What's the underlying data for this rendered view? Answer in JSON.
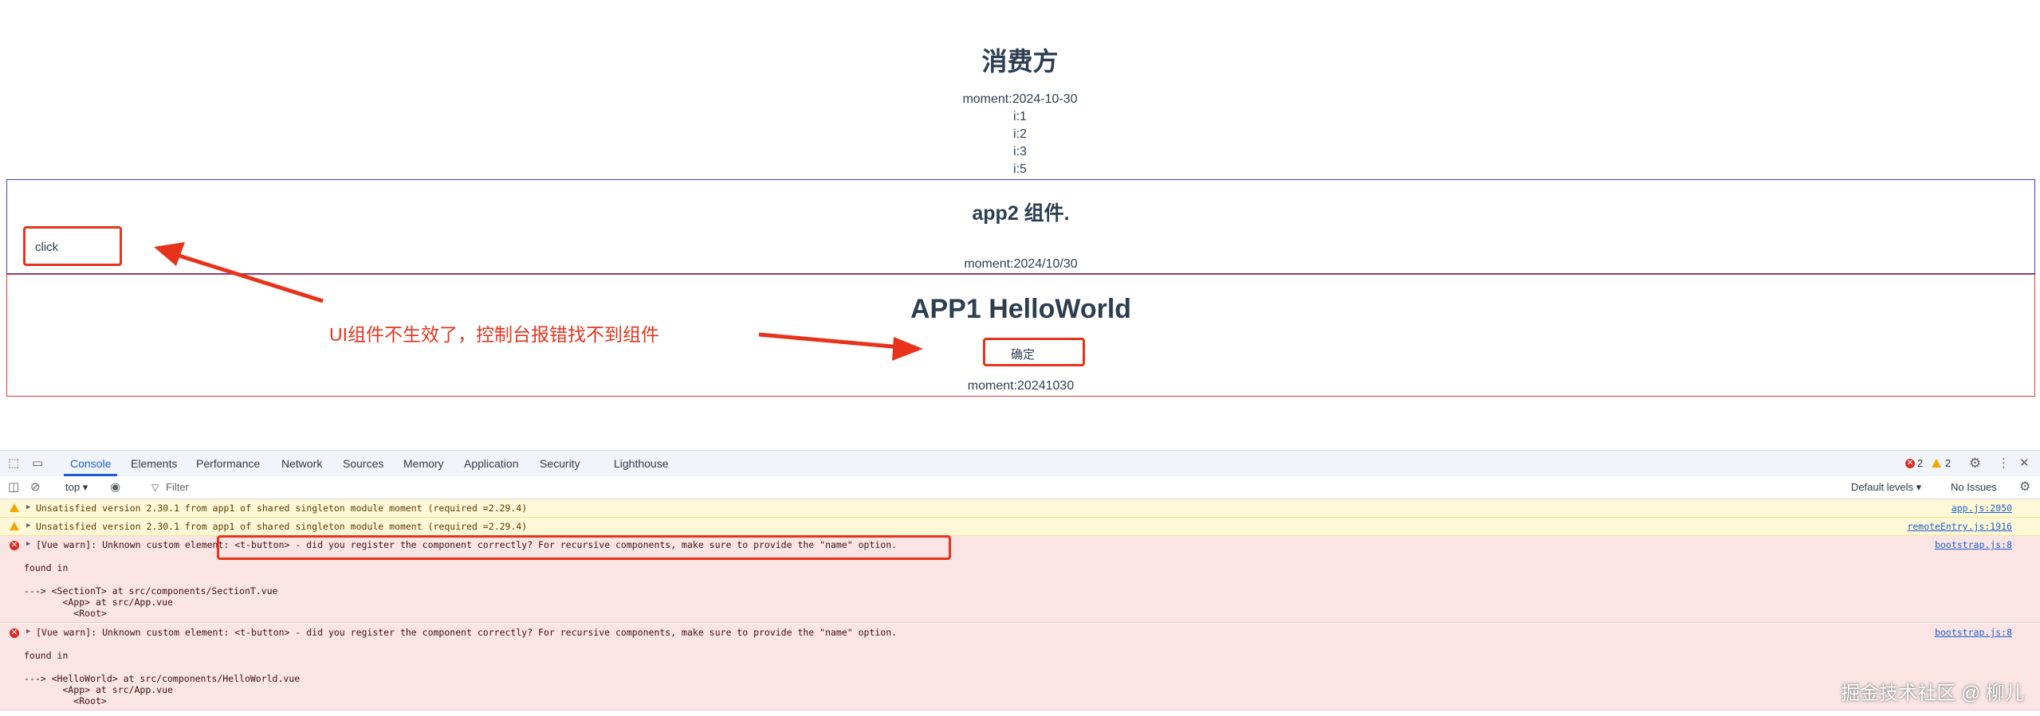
{
  "consumer": {
    "title": "消费方",
    "moment": "moment:2024-10-30",
    "items": [
      "i:1",
      "i:2",
      "i:3",
      "i:5"
    ]
  },
  "app2": {
    "title": "app2 组件.",
    "click_label": "click",
    "moment": "moment:2024/10/30"
  },
  "app1": {
    "title": "APP1 HelloWorld",
    "confirm_label": "确定",
    "moment": "moment:20241030"
  },
  "annotation": {
    "text": "UI组件不生效了，控制台报错找不到组件",
    "color": "#e8331c"
  },
  "devtools": {
    "tabs": [
      "Console",
      "Elements",
      "Performance",
      "Network",
      "Sources",
      "Memory",
      "Application",
      "Security",
      "Lighthouse"
    ],
    "active_tab": "Console",
    "error_count": "2",
    "warning_count": "2",
    "context": "top",
    "filter_placeholder": "Filter",
    "levels": "Default levels",
    "issues": "No Issues",
    "messages": [
      {
        "level": "warning",
        "text": "Unsatisfied version 2.30.1 from app1 of shared singleton module moment (required =2.29.4)",
        "source": "app.js:2050"
      },
      {
        "level": "warning",
        "text": "Unsatisfied version 2.30.1 from app1 of shared singleton module moment (required =2.29.4)",
        "source": "remoteEntry.js:1916"
      },
      {
        "level": "error",
        "text": "[Vue warn]: Unknown custom element: <t-button> - did you register the component correctly? For recursive components, make sure to provide the \"name\" option.",
        "source": "bootstrap.js:8",
        "found": "found in",
        "trace": [
          "---> <SectionT> at src/components/SectionT.vue",
          "       <App> at src/App.vue",
          "         <Root>"
        ]
      },
      {
        "level": "error",
        "text": "[Vue warn]: Unknown custom element: <t-button> - did you register the component correctly? For recursive components, make sure to provide the \"name\" option.",
        "source": "bootstrap.js:8",
        "found": "found in",
        "trace": [
          "---> <HelloWorld> at src/components/HelloWorld.vue",
          "       <App> at src/App.vue",
          "         <Root>"
        ]
      }
    ]
  },
  "watermark": "掘金技术社区 @ 柳儿"
}
